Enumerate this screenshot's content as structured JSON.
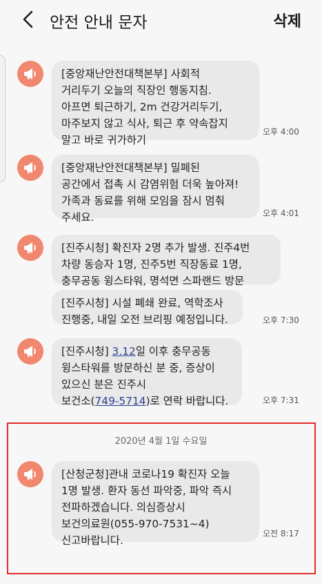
{
  "header": {
    "title": "안전 안내 문자",
    "delete_label": "삭제"
  },
  "messages": [
    {
      "text": "[중앙재난안전대책본부] 사회적\n거리두기 오늘의 직장인 행동지침.\n아프면 퇴근하기, 2m 건강거리두기,\n마주보지 않고 식사, 퇴근 후 약속잡지\n말고 바로 귀가하기",
      "time": "오후 4:00"
    },
    {
      "text": "[중앙재난안전대책본부] 밀폐된\n공간에서 접촉 시 감염위험 더욱 높아져!\n가족과 동료를 위해 모임을 잠시 멈춰\n주세요.",
      "time": "오후 4:01"
    },
    {
      "text": "[진주시청] 확진자 2명 추가 발생. 진주4번\n차량 동승자 1명, 진주5번 직장동료 1명,\n충무공동 윙스타워, 명석면 스파랜드 방문"
    },
    {
      "text": "[진주시청] 시설 폐쇄 완료, 역학조사\n진행중, 내일 오전 브리핑 예정입니다.",
      "time": "오후 7:30"
    },
    {
      "prefix": "[진주시청] ",
      "link1": "3.12",
      "middle": "일 이후 충무공동\n윙스타워를 방문하신 분 중, 증상이\n있으신 분은 진주시\n보건소(",
      "link2": "749-5714",
      "suffix": ")로 연락 바랍니다.",
      "time": "오후 7:31"
    },
    {
      "text": "[산청군청]관내 코로나19 확진자 오늘\n1명 발생. 환자 동선 파악중, 파악 즉시\n전파하겠습니다. 의심증상시\n보건의료원(055-970-7531~4)\n신고바랍니다.",
      "time": "오전 8:17"
    }
  ],
  "date_separator": "2020년 4월 1일 수요일",
  "icons": {
    "back": "chevron-left-icon",
    "alert": "megaphone-icon"
  },
  "colors": {
    "icon_bg": "#f0876e",
    "bubble_bg": "#e9e9e9",
    "link": "#2b3f8e",
    "highlight": "#e22b2b"
  }
}
